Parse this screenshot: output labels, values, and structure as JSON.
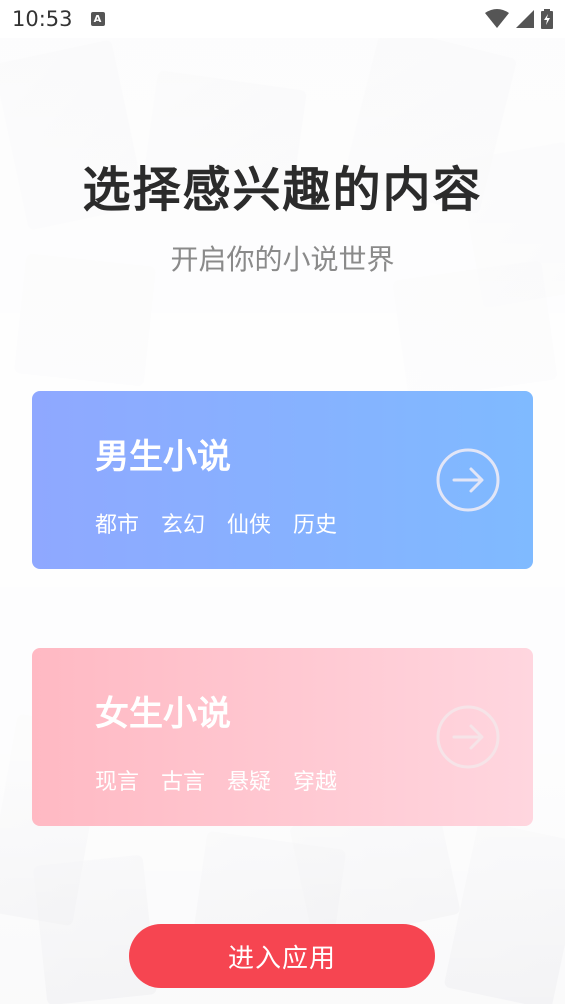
{
  "status_bar": {
    "time": "10:53",
    "notification_icon": "a-icon",
    "icons": [
      "wifi-icon",
      "signal-icon",
      "battery-icon"
    ]
  },
  "header": {
    "title": "选择感兴趣的内容",
    "subtitle": "开启你的小说世界"
  },
  "categories": [
    {
      "label": "男生小说",
      "tags": [
        "都市",
        "玄幻",
        "仙侠",
        "历史"
      ],
      "gradient": [
        "#8fa8ff",
        "#7fbaff"
      ],
      "icon": "arrow-right-circle-icon"
    },
    {
      "label": "女生小说",
      "tags": [
        "现言",
        "古言",
        "悬疑",
        "穿越"
      ],
      "gradient": [
        "#ffb9c3",
        "#ffd6df"
      ],
      "icon": "arrow-right-circle-icon"
    }
  ],
  "enter_button": {
    "label": "进入应用",
    "color": "#f64551"
  }
}
